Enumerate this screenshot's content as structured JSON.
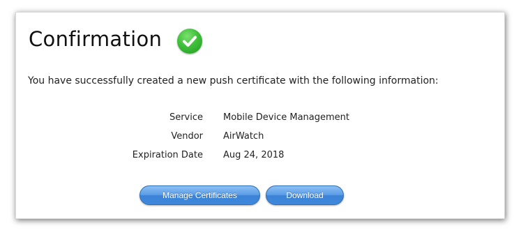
{
  "confirmation": {
    "title": "Confirmation",
    "status_icon": "check-circle-icon",
    "status_color": "#3fbf3a",
    "message": "You have successfully created a new push certificate with the following information:",
    "details": [
      {
        "label": "Service",
        "value": "Mobile Device Management"
      },
      {
        "label": "Vendor",
        "value": "AirWatch"
      },
      {
        "label": "Expiration Date",
        "value": "Aug 24, 2018"
      }
    ],
    "buttons": {
      "manage_label": "Manage Certificates",
      "download_label": "Download"
    },
    "accent_color": "#3b82d6"
  }
}
